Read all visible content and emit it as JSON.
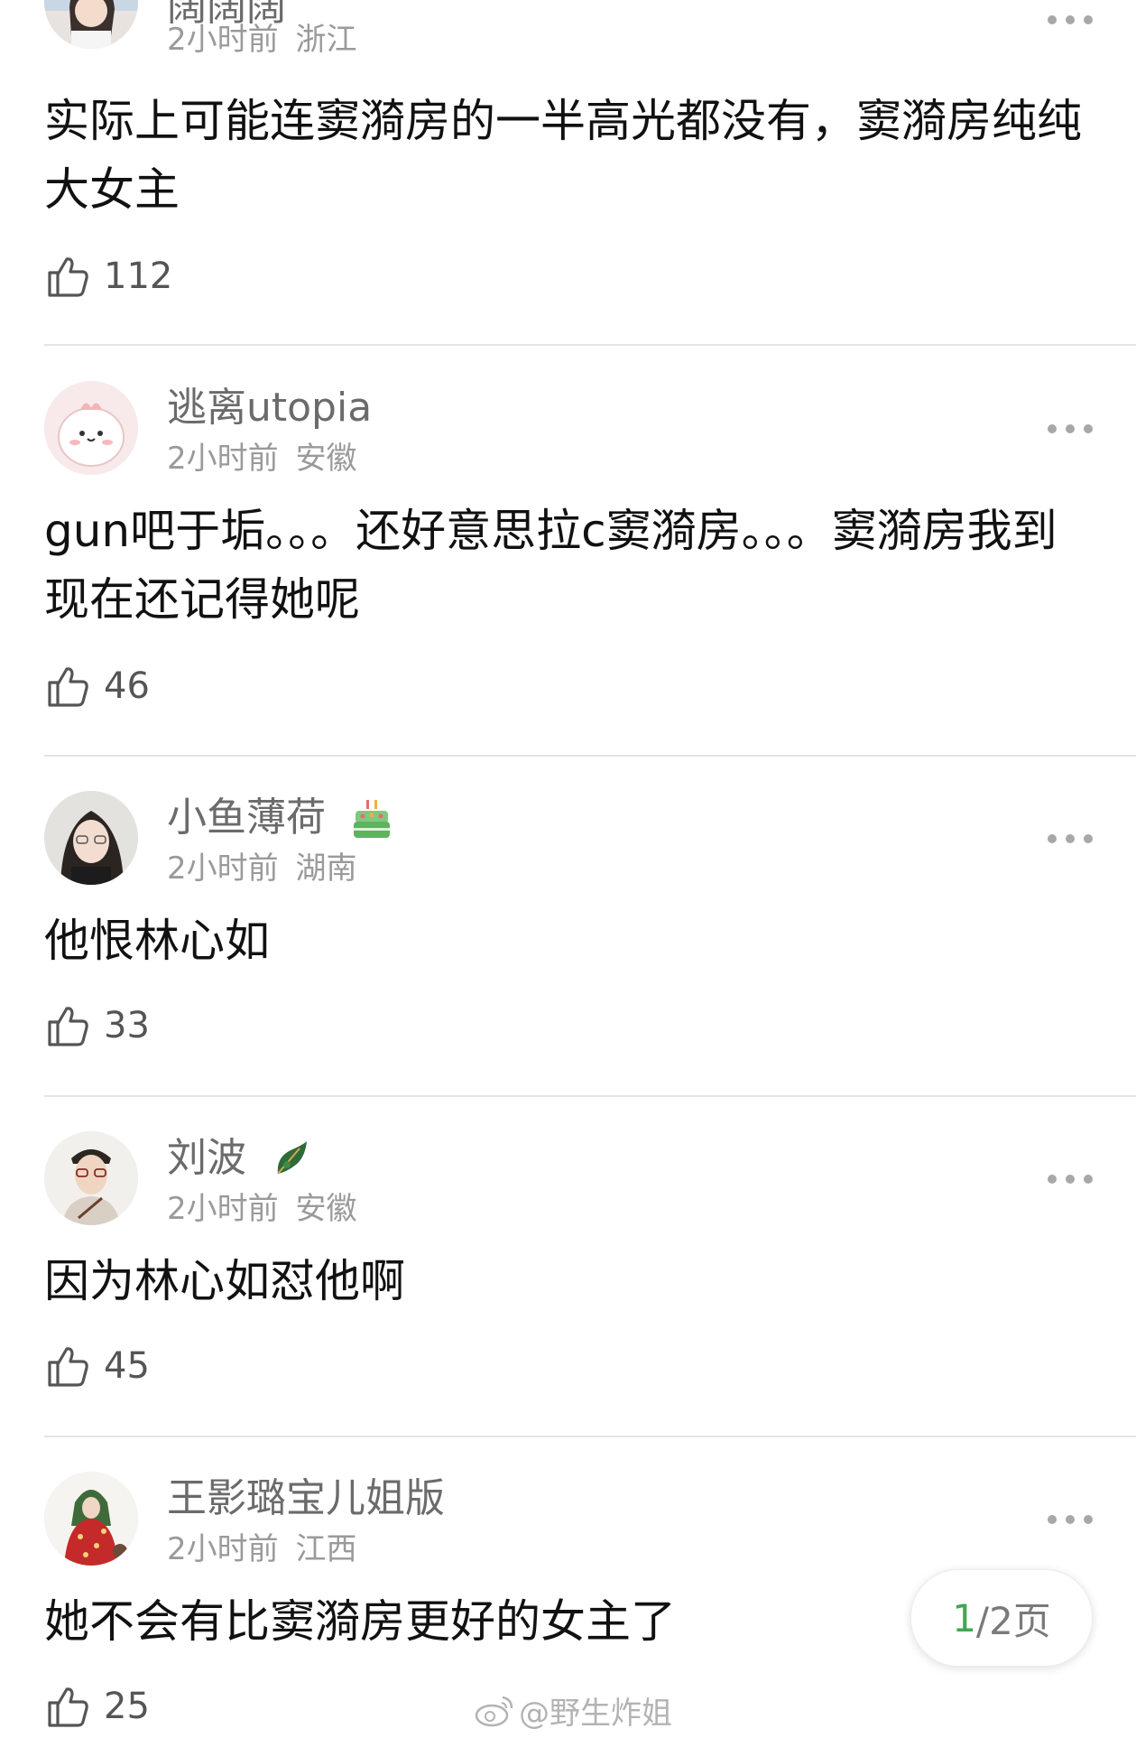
{
  "comments": [
    {
      "username": "阔阔阔",
      "time": "2小时前",
      "location": "浙江",
      "text": "实际上可能连窦漪房的一半高光都没有，窦漪房纯纯大女主",
      "likes": "112",
      "avatar": "girl-photo-avatar"
    },
    {
      "username": "逃离utopia",
      "time": "2小时前",
      "location": "安徽",
      "text": "gun吧于垢。。。还好意思拉c窦漪房。。。窦漪房我到现在还记得她呢",
      "likes": "46",
      "avatar": "cartoon-dino-avatar"
    },
    {
      "username": "小鱼薄荷",
      "time": "2小时前",
      "location": "湖南",
      "text": "他恨林心如",
      "likes": "33",
      "avatar": "girl-glasses-avatar",
      "badge": "birthday-cake-icon"
    },
    {
      "username": "刘波",
      "time": "2小时前",
      "location": "安徽",
      "text": "因为林心如怼他啊",
      "likes": "45",
      "avatar": "man-glasses-avatar",
      "badge": "green-leaf-badge-icon"
    },
    {
      "username": "王影璐宝儿姐版",
      "time": "2小时前",
      "location": "江西",
      "text": "她不会有比窦漪房更好的女主了",
      "likes": "25",
      "avatar": "red-dress-figure-avatar"
    }
  ],
  "pagination": {
    "current": "1",
    "total_label": "/2页"
  },
  "watermark": "@野生炸姐",
  "colors": {
    "accent_green": "#3ea851",
    "username_gray": "#6b6b6b",
    "meta_gray": "#9a9a9a"
  }
}
